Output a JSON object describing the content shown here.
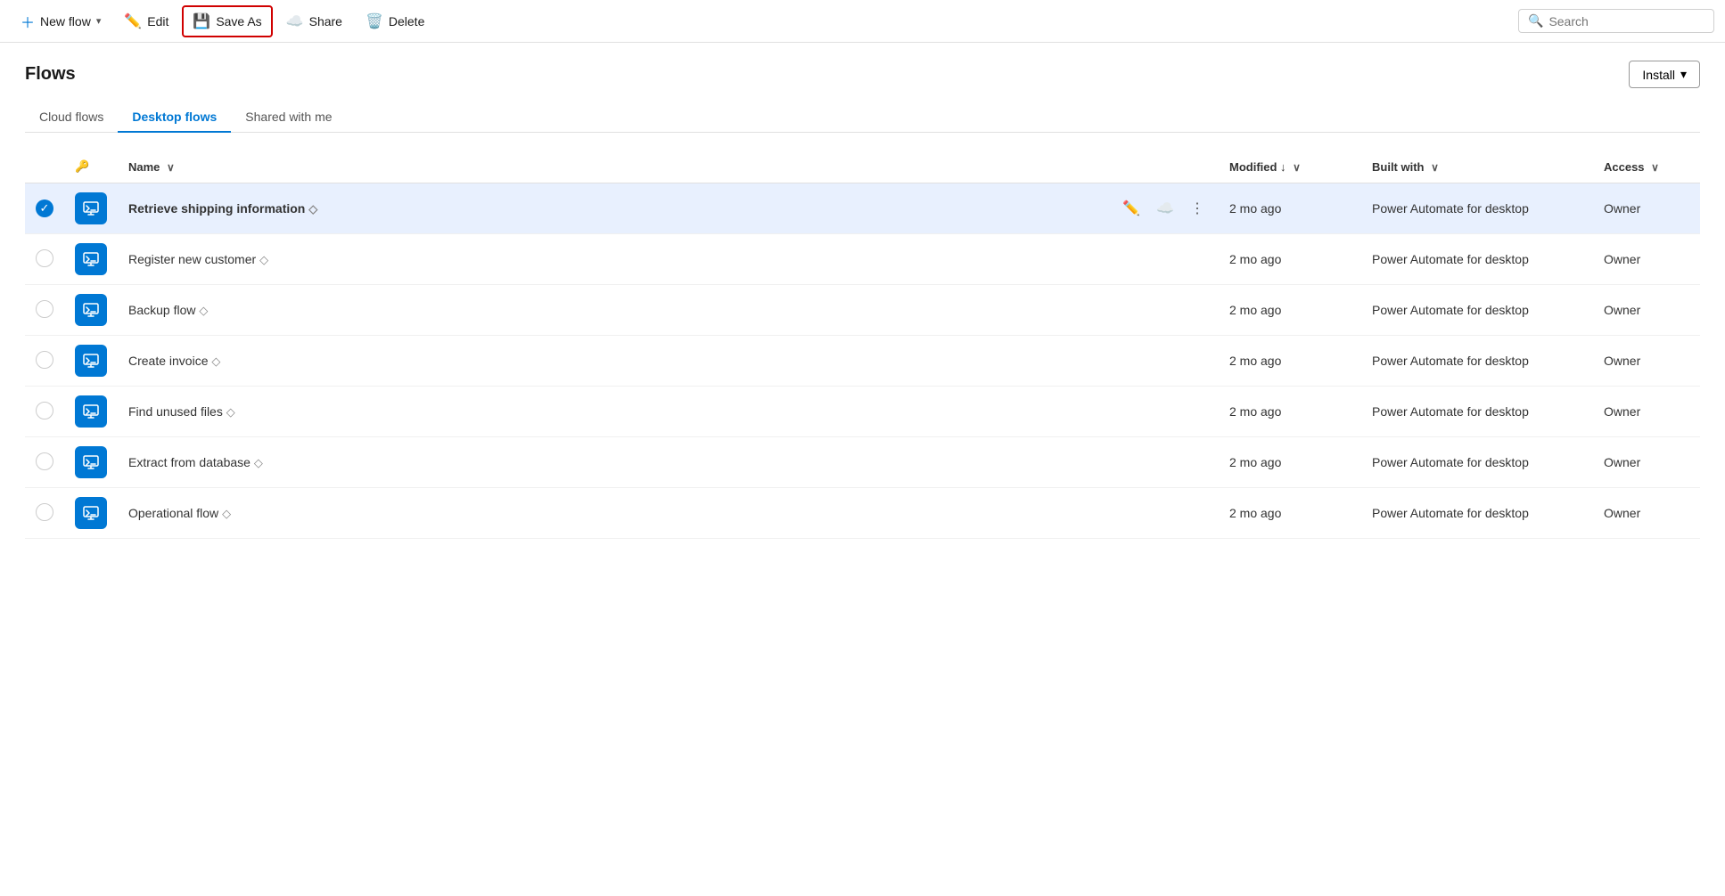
{
  "toolbar": {
    "new_flow_label": "New flow",
    "edit_label": "Edit",
    "save_as_label": "Save As",
    "share_label": "Share",
    "delete_label": "Delete",
    "search_placeholder": "Search"
  },
  "page": {
    "title": "Flows",
    "install_label": "Install"
  },
  "tabs": [
    {
      "id": "cloud",
      "label": "Cloud flows",
      "active": false
    },
    {
      "id": "desktop",
      "label": "Desktop flows",
      "active": true
    },
    {
      "id": "shared",
      "label": "Shared with me",
      "active": false
    }
  ],
  "table": {
    "columns": [
      {
        "id": "check",
        "label": ""
      },
      {
        "id": "icon",
        "label": "🔑"
      },
      {
        "id": "name",
        "label": "Name",
        "sortable": true
      },
      {
        "id": "modified",
        "label": "Modified",
        "sortable": true,
        "sorted": true
      },
      {
        "id": "built_with",
        "label": "Built with",
        "sortable": true
      },
      {
        "id": "access",
        "label": "Access",
        "sortable": true
      }
    ],
    "rows": [
      {
        "id": 1,
        "selected": true,
        "name": "Retrieve shipping information",
        "modified": "2 mo ago",
        "built_with": "Power Automate for desktop",
        "access": "Owner",
        "has_actions": true
      },
      {
        "id": 2,
        "selected": false,
        "name": "Register new customer",
        "modified": "2 mo ago",
        "built_with": "Power Automate for desktop",
        "access": "Owner",
        "has_actions": false
      },
      {
        "id": 3,
        "selected": false,
        "name": "Backup flow",
        "modified": "2 mo ago",
        "built_with": "Power Automate for desktop",
        "access": "Owner",
        "has_actions": false
      },
      {
        "id": 4,
        "selected": false,
        "name": "Create invoice",
        "modified": "2 mo ago",
        "built_with": "Power Automate for desktop",
        "access": "Owner",
        "has_actions": false
      },
      {
        "id": 5,
        "selected": false,
        "name": "Find unused files",
        "modified": "2 mo ago",
        "built_with": "Power Automate for desktop",
        "access": "Owner",
        "has_actions": false
      },
      {
        "id": 6,
        "selected": false,
        "name": "Extract from database",
        "modified": "2 mo ago",
        "built_with": "Power Automate for desktop",
        "access": "Owner",
        "has_actions": false
      },
      {
        "id": 7,
        "selected": false,
        "name": "Operational flow",
        "modified": "2 mo ago",
        "built_with": "Power Automate for desktop",
        "access": "Owner",
        "has_actions": false
      }
    ]
  }
}
